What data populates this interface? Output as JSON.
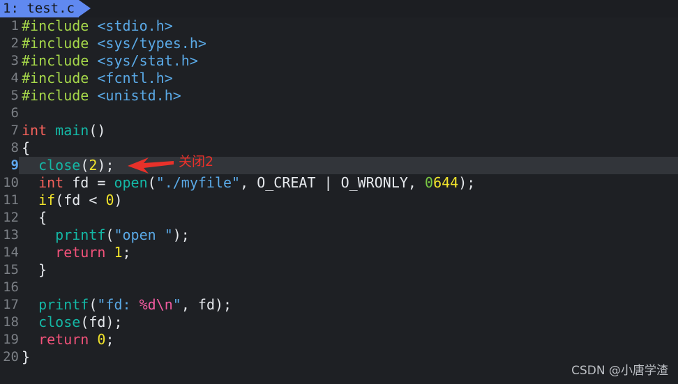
{
  "window": {
    "background_color": "#1e2024",
    "kind": "text-editor"
  },
  "tabbar": {
    "active_tab": {
      "label": "1: test.c",
      "index": "1",
      "filename": "test.c",
      "background_color": "#6089f0",
      "text_color": "#141618"
    }
  },
  "editor": {
    "current_line": 9,
    "current_line_highlight_color": "#32353a",
    "gutter_color": "#7b7f85",
    "gutter_active_color": "#5fa8f0",
    "lines": [
      {
        "n": "1",
        "segments": [
          {
            "t": "#include ",
            "c": "t-pre"
          },
          {
            "t": "<stdio.h>",
            "c": "t-hdr"
          }
        ]
      },
      {
        "n": "2",
        "segments": [
          {
            "t": "#include ",
            "c": "t-pre"
          },
          {
            "t": "<sys/types.h>",
            "c": "t-hdr"
          }
        ]
      },
      {
        "n": "3",
        "segments": [
          {
            "t": "#include ",
            "c": "t-pre"
          },
          {
            "t": "<sys/stat.h>",
            "c": "t-hdr"
          }
        ]
      },
      {
        "n": "4",
        "segments": [
          {
            "t": "#include ",
            "c": "t-pre"
          },
          {
            "t": "<fcntl.h>",
            "c": "t-hdr"
          }
        ]
      },
      {
        "n": "5",
        "segments": [
          {
            "t": "#include ",
            "c": "t-pre"
          },
          {
            "t": "<unistd.h>",
            "c": "t-hdr"
          }
        ]
      },
      {
        "n": "6",
        "segments": []
      },
      {
        "n": "7",
        "segments": [
          {
            "t": "int ",
            "c": "t-type"
          },
          {
            "t": "main",
            "c": "t-fn"
          },
          {
            "t": "()",
            "c": "t-plain"
          }
        ]
      },
      {
        "n": "8",
        "segments": [
          {
            "t": "{",
            "c": "t-plain"
          }
        ]
      },
      {
        "n": "9",
        "highlight": true,
        "segments": [
          {
            "t": "  ",
            "c": "t-plain"
          },
          {
            "t": "close",
            "c": "t-fn"
          },
          {
            "t": "(",
            "c": "t-plain"
          },
          {
            "t": "2",
            "c": "t-num"
          },
          {
            "t": ");",
            "c": "t-plain"
          }
        ]
      },
      {
        "n": "10",
        "segments": [
          {
            "t": "  ",
            "c": "t-plain"
          },
          {
            "t": "int",
            "c": "t-type"
          },
          {
            "t": " fd = ",
            "c": "t-plain"
          },
          {
            "t": "open",
            "c": "t-fn"
          },
          {
            "t": "(",
            "c": "t-plain"
          },
          {
            "t": "\"./myfile\"",
            "c": "t-hdr"
          },
          {
            "t": ", O_CREAT | O_WRONLY, ",
            "c": "t-plain"
          },
          {
            "t": "0",
            "c": "t-numz"
          },
          {
            "t": "644",
            "c": "t-num"
          },
          {
            "t": ");",
            "c": "t-plain"
          }
        ]
      },
      {
        "n": "11",
        "segments": [
          {
            "t": "  ",
            "c": "t-plain"
          },
          {
            "t": "if",
            "c": "t-kw"
          },
          {
            "t": "(fd < ",
            "c": "t-plain"
          },
          {
            "t": "0",
            "c": "t-num"
          },
          {
            "t": ")",
            "c": "t-plain"
          }
        ]
      },
      {
        "n": "12",
        "segments": [
          {
            "t": "  {",
            "c": "t-plain"
          }
        ]
      },
      {
        "n": "13",
        "segments": [
          {
            "t": "    ",
            "c": "t-plain"
          },
          {
            "t": "printf",
            "c": "t-fn"
          },
          {
            "t": "(",
            "c": "t-plain"
          },
          {
            "t": "\"open \"",
            "c": "t-hdr"
          },
          {
            "t": ");",
            "c": "t-plain"
          }
        ]
      },
      {
        "n": "14",
        "segments": [
          {
            "t": "    ",
            "c": "t-plain"
          },
          {
            "t": "return",
            "c": "t-ret"
          },
          {
            "t": " ",
            "c": "t-plain"
          },
          {
            "t": "1",
            "c": "t-num"
          },
          {
            "t": ";",
            "c": "t-plain"
          }
        ]
      },
      {
        "n": "15",
        "segments": [
          {
            "t": "  }",
            "c": "t-plain"
          }
        ]
      },
      {
        "n": "16",
        "segments": []
      },
      {
        "n": "17",
        "segments": [
          {
            "t": "  ",
            "c": "t-plain"
          },
          {
            "t": "printf",
            "c": "t-fn"
          },
          {
            "t": "(",
            "c": "t-plain"
          },
          {
            "t": "\"fd: ",
            "c": "t-hdr"
          },
          {
            "t": "%d\\n",
            "c": "t-fmt"
          },
          {
            "t": "\"",
            "c": "t-hdr"
          },
          {
            "t": ", fd);",
            "c": "t-plain"
          }
        ]
      },
      {
        "n": "18",
        "segments": [
          {
            "t": "  ",
            "c": "t-plain"
          },
          {
            "t": "close",
            "c": "t-fn"
          },
          {
            "t": "(fd);",
            "c": "t-plain"
          }
        ]
      },
      {
        "n": "19",
        "segments": [
          {
            "t": "  ",
            "c": "t-plain"
          },
          {
            "t": "return",
            "c": "t-ret"
          },
          {
            "t": " ",
            "c": "t-plain"
          },
          {
            "t": "0",
            "c": "t-num"
          },
          {
            "t": ";",
            "c": "t-plain"
          }
        ]
      },
      {
        "n": "20",
        "segments": [
          {
            "t": "}",
            "c": "t-plain"
          }
        ]
      }
    ]
  },
  "annotation": {
    "label": "关闭2",
    "color": "#e8312a",
    "arrow": {
      "direction": "left",
      "color": "#e8312a",
      "points_to_line": 9
    }
  },
  "watermark": {
    "text": "CSDN @小唐学渣",
    "color": "#c9ccd1"
  }
}
